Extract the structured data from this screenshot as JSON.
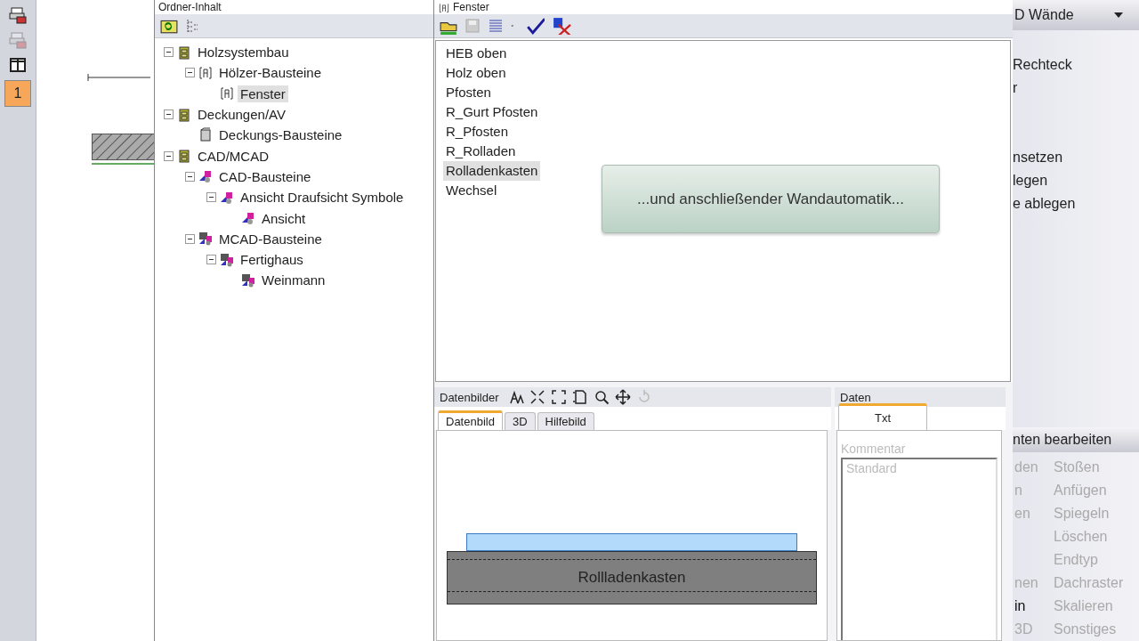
{
  "left_tools": [
    {
      "kind": "print",
      "disabled": false
    },
    {
      "kind": "print",
      "disabled": true
    },
    {
      "kind": "split",
      "disabled": false
    },
    {
      "kind": "number",
      "label": "1",
      "selected": true,
      "disabled": false
    }
  ],
  "folder_panel": {
    "title": "Ordner-Inhalt",
    "tree": [
      {
        "label": "Holzsystembau",
        "kind": "cabinet",
        "expanded": true,
        "selected": false,
        "children": [
          {
            "label": "Hölzer-Bausteine",
            "kind": "bracket",
            "expanded": true,
            "selected": false,
            "children": [
              {
                "label": "Fenster",
                "kind": "bracket",
                "selected": true
              }
            ]
          }
        ]
      },
      {
        "label": "Deckungen/AV",
        "kind": "cabinet",
        "expanded": true,
        "selected": false,
        "children": [
          {
            "label": "Deckungs-Bausteine",
            "kind": "cover",
            "selected": false
          }
        ]
      },
      {
        "label": "CAD/MCAD",
        "kind": "cabinet",
        "expanded": true,
        "selected": false,
        "children": [
          {
            "label": "CAD-Bausteine",
            "kind": "cad",
            "expanded": true,
            "selected": false,
            "children": [
              {
                "label": "Ansicht Draufsicht Symbole",
                "kind": "cad",
                "expanded": true,
                "selected": false,
                "children": [
                  {
                    "label": "Ansicht",
                    "kind": "cad",
                    "selected": false
                  }
                ]
              }
            ]
          },
          {
            "label": "MCAD-Bausteine",
            "kind": "mcad",
            "expanded": true,
            "selected": false,
            "children": [
              {
                "label": "Fertighaus",
                "kind": "mcad",
                "expanded": true,
                "selected": false,
                "children": [
                  {
                    "label": "Weinmann",
                    "kind": "mcad",
                    "selected": false
                  }
                ]
              }
            ]
          }
        ]
      }
    ]
  },
  "list_panel": {
    "title": "Fenster",
    "items": [
      {
        "label": "HEB oben",
        "selected": false
      },
      {
        "label": "Holz oben",
        "selected": false
      },
      {
        "label": "Pfosten",
        "selected": false
      },
      {
        "label": "R_Gurt Pfosten",
        "selected": false
      },
      {
        "label": "R_Pfosten",
        "selected": false
      },
      {
        "label": "R_Rolladen",
        "selected": false
      },
      {
        "label": "Rolladenkasten",
        "selected": true
      },
      {
        "label": "Wechsel",
        "selected": false
      }
    ]
  },
  "tooltip": {
    "text": "...und anschließender Wandautomatik..."
  },
  "images_panel": {
    "title": "Datenbilder",
    "tabs": [
      {
        "label": "Datenbild",
        "selected": true
      },
      {
        "label": "3D",
        "selected": false
      },
      {
        "label": "Hilfebild",
        "selected": false
      }
    ],
    "drawing_label": "Rollladenkasten"
  },
  "data_panel": {
    "title": "Daten",
    "tabs": [
      {
        "label": "Txt",
        "selected": true
      }
    ],
    "field_label": "Kommentar",
    "field_value": "Standard"
  },
  "right_panel": {
    "dropdown": "D Wände",
    "menu_groups": [
      [
        "Rechteck",
        "r"
      ],
      [
        "nsetzen",
        "legen",
        "e ablegen"
      ]
    ],
    "section": "nten bearbeiten",
    "rows": [
      {
        "left": "den",
        "left_disabled": true,
        "right": "Stoßen"
      },
      {
        "left": "n",
        "left_disabled": true,
        "right": "Anfügen"
      },
      {
        "left": "en",
        "left_disabled": true,
        "right": "Spiegeln"
      },
      {
        "right": "Löschen"
      },
      {
        "right": "Endtyp"
      },
      {
        "left": "nen",
        "left_disabled": true,
        "right": "Dachraster"
      },
      {
        "left": "in",
        "left_disabled": false,
        "right": "Skalieren"
      },
      {
        "left": "3D",
        "left_disabled": true,
        "right": "Sonstiges"
      }
    ]
  }
}
